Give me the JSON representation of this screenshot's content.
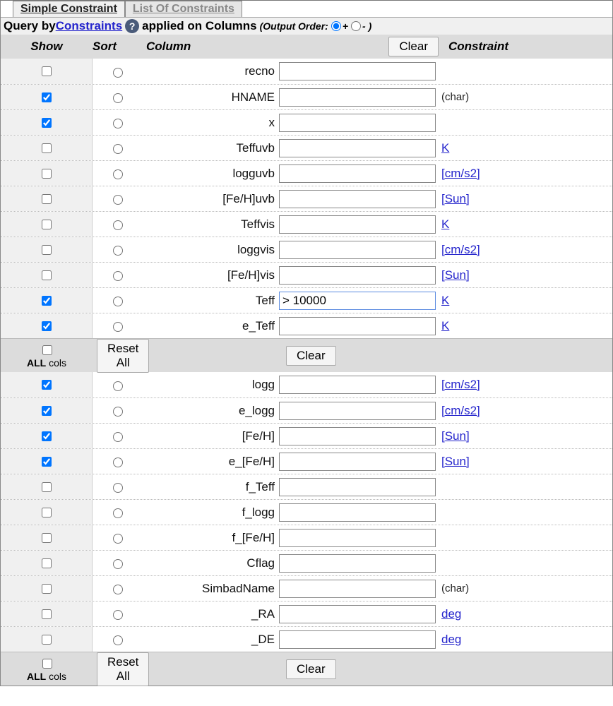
{
  "tabs": {
    "simple": "Simple Constraint",
    "list": "List Of Constraints"
  },
  "query_bar": {
    "prefix": "Query by ",
    "constraints_link": "Constraints ",
    "applied": " applied on Columns ",
    "order_prefix": "(Output Order: ",
    "plus": "+ ",
    "minus": "- )"
  },
  "headers": {
    "show": "Show",
    "sort": "Sort",
    "column": "Column",
    "clear": "Clear",
    "constraint": "Constraint"
  },
  "actions": {
    "reset_all": "Reset All",
    "clear": "Clear",
    "all_cols_bold": "ALL",
    "all_cols_rest": " cols"
  },
  "rows1": [
    {
      "show": false,
      "col": "recno",
      "val": "",
      "constr": "",
      "link": false
    },
    {
      "show": true,
      "col": "HNAME",
      "val": "",
      "constr": "(char)",
      "link": false
    },
    {
      "show": true,
      "col": "x",
      "val": "",
      "constr": "",
      "link": false
    },
    {
      "show": false,
      "col": "Teffuvb",
      "val": "",
      "constr": "K",
      "link": true
    },
    {
      "show": false,
      "col": "logguvb",
      "val": "",
      "constr": "[cm/s2]",
      "link": true
    },
    {
      "show": false,
      "col": "[Fe/H]uvb",
      "val": "",
      "constr": "[Sun]",
      "link": true
    },
    {
      "show": false,
      "col": "Teffvis",
      "val": "",
      "constr": "K",
      "link": true
    },
    {
      "show": false,
      "col": "loggvis",
      "val": "",
      "constr": "[cm/s2]",
      "link": true
    },
    {
      "show": false,
      "col": "[Fe/H]vis",
      "val": "",
      "constr": "[Sun]",
      "link": true
    },
    {
      "show": true,
      "col": "Teff",
      "val": "> 10000",
      "constr": "K",
      "link": true,
      "active": true
    },
    {
      "show": true,
      "col": "e_Teff",
      "val": "",
      "constr": "K",
      "link": true
    }
  ],
  "rows2": [
    {
      "show": true,
      "col": "logg",
      "val": "",
      "constr": "[cm/s2]",
      "link": true
    },
    {
      "show": true,
      "col": "e_logg",
      "val": "",
      "constr": "[cm/s2]",
      "link": true
    },
    {
      "show": true,
      "col": "[Fe/H]",
      "val": "",
      "constr": "[Sun]",
      "link": true
    },
    {
      "show": true,
      "col": "e_[Fe/H]",
      "val": "",
      "constr": "[Sun]",
      "link": true
    },
    {
      "show": false,
      "col": "f_Teff",
      "val": "",
      "constr": "",
      "link": false
    },
    {
      "show": false,
      "col": "f_logg",
      "val": "",
      "constr": "",
      "link": false
    },
    {
      "show": false,
      "col": "f_[Fe/H]",
      "val": "",
      "constr": "",
      "link": false
    },
    {
      "show": false,
      "col": "Cflag",
      "val": "",
      "constr": "",
      "link": false
    },
    {
      "show": false,
      "col": "SimbadName",
      "val": "",
      "constr": "(char)",
      "link": false
    },
    {
      "show": false,
      "col": "_RA",
      "val": "",
      "constr": "deg",
      "link": true
    },
    {
      "show": false,
      "col": "_DE",
      "val": "",
      "constr": "deg",
      "link": true
    }
  ]
}
